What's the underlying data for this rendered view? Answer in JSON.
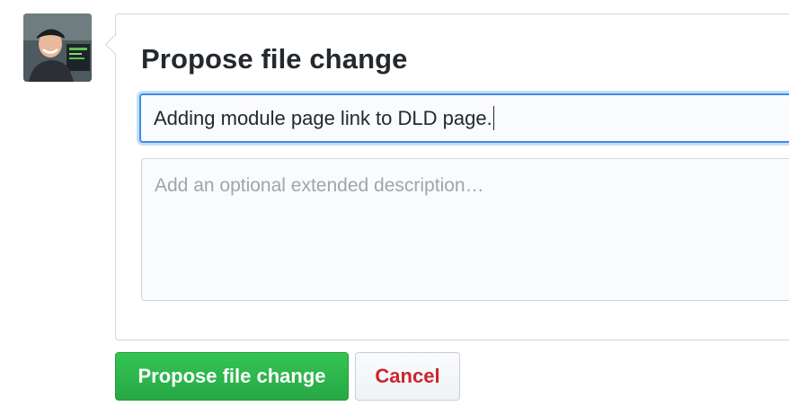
{
  "form": {
    "title": "Propose file change",
    "summary_value": "Adding module page link to DLD page.",
    "description_placeholder": "Add an optional extended description…"
  },
  "buttons": {
    "propose_label": "Propose file change",
    "cancel_label": "Cancel"
  },
  "colors": {
    "primary_green": "#28a745",
    "cancel_red": "#cb2431",
    "focus_blue": "#3a8ee6"
  }
}
